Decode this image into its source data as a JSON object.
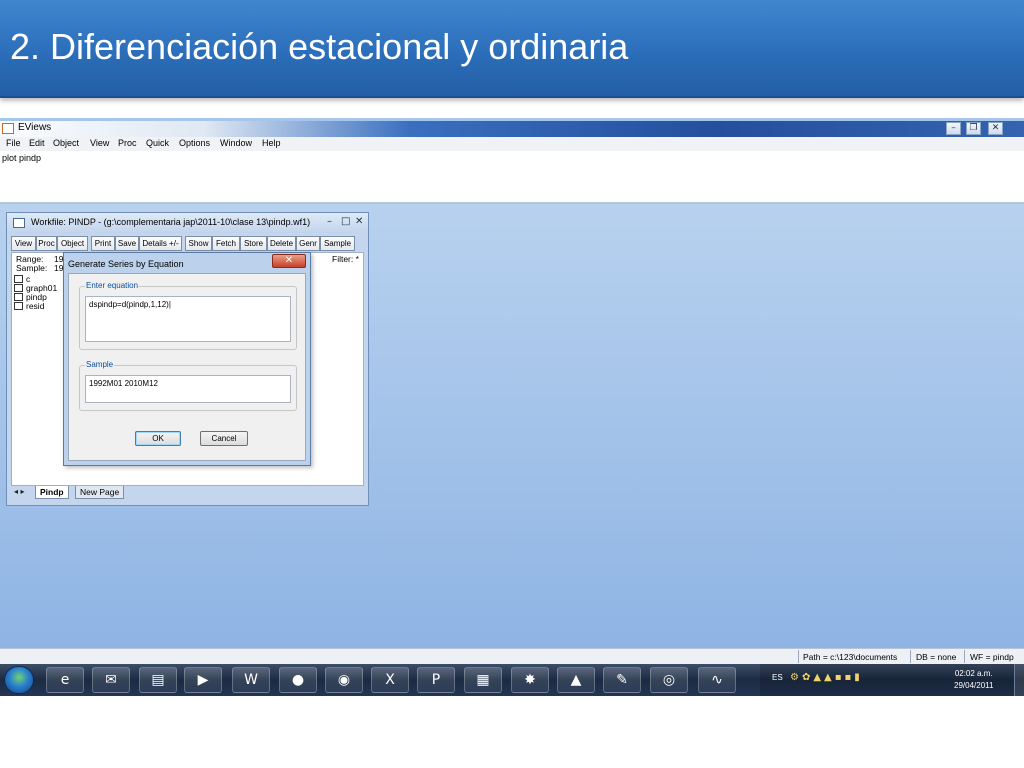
{
  "slide": {
    "title": "2. Diferenciación estacional y ordinaria"
  },
  "app": {
    "name": "EViews",
    "menu": [
      "File",
      "Edit",
      "Object",
      "View",
      "Proc",
      "Quick",
      "Options",
      "Window",
      "Help"
    ],
    "command": "plot pindp"
  },
  "workfile": {
    "title": "Workfile: PINDP - (g:\\complementaria jap\\2011-10\\clase 13\\pindp.wf1)",
    "toolbar": [
      "View",
      "Proc",
      "Object",
      "Print",
      "Save",
      "Details +/-",
      "Show",
      "Fetch",
      "Store",
      "Delete",
      "Genr",
      "Sample"
    ],
    "range_label": "Range:",
    "range_value": "19",
    "sample_label": "Sample:",
    "sample_value": "19",
    "filter": "Filter: *",
    "objects": [
      "c",
      "graph01",
      "pindp",
      "resid"
    ],
    "tabs": [
      "Pindp",
      "New Page"
    ]
  },
  "dialog": {
    "title": "Generate Series by Equation",
    "close": "✕",
    "equation_label": "Enter equation",
    "equation_value": "dspindp=d(pindp,1,12)|",
    "sample_label": "Sample",
    "sample_value": "1992M01 2010M12",
    "ok": "OK",
    "cancel": "Cancel"
  },
  "statusbar": {
    "path": "Path = c:\\123\\documents",
    "db": "DB = none",
    "wf": "WF = pindp"
  },
  "taskbar": {
    "icons": [
      "ie-icon",
      "outlook-icon",
      "explorer-icon",
      "media-player-icon",
      "word-icon",
      "firefox-icon",
      "chrome-icon",
      "excel-icon",
      "powerpoint-icon",
      "calculator-icon",
      "purple-app-icon",
      "matlab-icon",
      "acrobat-icon",
      "camera-app-icon",
      "eviews-icon"
    ],
    "language": "ES",
    "time": "02:02 a.m.",
    "date": "29/04/2011"
  }
}
